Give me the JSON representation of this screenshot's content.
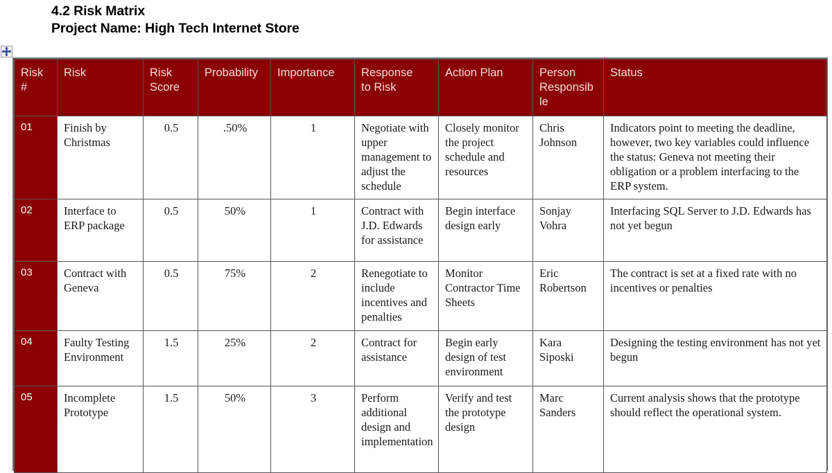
{
  "document": {
    "section_title": "4.2 Risk Matrix",
    "project_line": "Project Name: High Tech Internet Store"
  },
  "handle": {
    "icon": "table-move-handle-icon"
  },
  "colors": {
    "header_background": "#8B0000",
    "header_text": "#F2DEDE",
    "risk_number_background": "#8B0000",
    "risk_number_text": "#FFFFFF",
    "body_text": "#1A1A1A",
    "grid_line": "#55555A",
    "table_border": "#6E6E6E",
    "page_background": "#FFFFFF"
  },
  "table": {
    "columns": [
      {
        "key": "risk_number",
        "label": "Risk\n#"
      },
      {
        "key": "risk",
        "label": "Risk"
      },
      {
        "key": "risk_score",
        "label": "Risk\nScore"
      },
      {
        "key": "probability",
        "label": "Probability"
      },
      {
        "key": "importance",
        "label": "Importance"
      },
      {
        "key": "response_to_risk",
        "label": "Response\nto Risk"
      },
      {
        "key": "action_plan",
        "label": "Action Plan"
      },
      {
        "key": "person_responsible",
        "label": "Person\nResponsib\nle"
      },
      {
        "key": "status",
        "label": "Status"
      }
    ],
    "rows": [
      {
        "risk_number": "01",
        "risk": "Finish by Christmas",
        "risk_score": "0.5",
        "probability": ".50%",
        "importance": "1",
        "response_to_risk": "Negotiate with upper management to adjust the schedule",
        "action_plan": "Closely monitor the project schedule and resources",
        "person_responsible": "Chris Johnson",
        "status": "Indicators point to meeting the deadline, however, two key variables could influence the status:  Geneva not meeting their obligation or a problem interfacing to the ERP system."
      },
      {
        "risk_number": "02",
        "risk": "Interface to ERP package",
        "risk_score": "0.5",
        "probability": "50%",
        "importance": "1",
        "response_to_risk": "Contract with J.D. Edwards for assistance",
        "action_plan": "Begin interface design early",
        "person_responsible": "Sonjay Vohra",
        "status": "Interfacing SQL Server to J.D. Edwards has not yet begun"
      },
      {
        "risk_number": "03",
        "risk": "Contract with Geneva",
        "risk_score": "0.5",
        "probability": "75%",
        "importance": "2",
        "response_to_risk": "Renegotiate to include incentives and penalties",
        "action_plan": "Monitor Contractor Time Sheets",
        "person_responsible": "Eric Robertson",
        "status": "The contract is set at a fixed rate with no incentives or penalties"
      },
      {
        "risk_number": "04",
        "risk": "Faulty Testing Environment",
        "risk_score": "1.5",
        "probability": "25%",
        "importance": "2",
        "response_to_risk": "Contract for assistance",
        "action_plan": "Begin early design of test environment",
        "person_responsible": "Kara Siposki",
        "status": "Designing the testing environment has not yet begun"
      },
      {
        "risk_number": "05",
        "risk": "Incomplete Prototype",
        "risk_score": "1.5",
        "probability": "50%",
        "importance": "3",
        "response_to_risk": "Perform additional design and implementation",
        "action_plan": "Verify and test the prototype design",
        "person_responsible": "Marc Sanders",
        "status": "Current analysis shows that the prototype should reflect the operational system."
      }
    ]
  }
}
